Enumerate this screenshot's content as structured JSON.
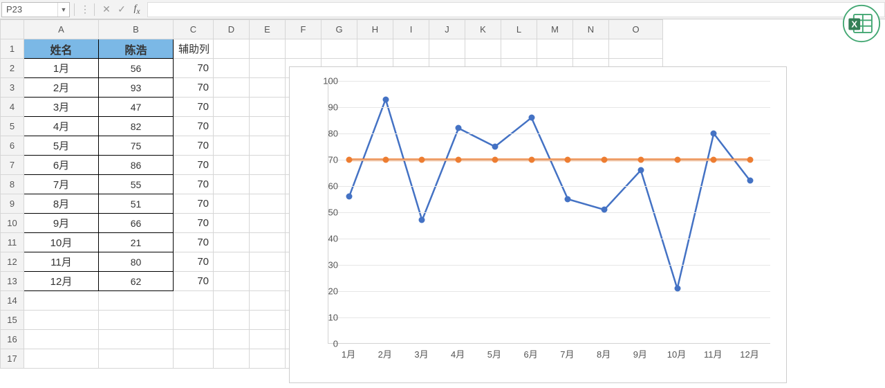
{
  "formula_bar": {
    "cell_ref": "P23",
    "formula": ""
  },
  "columns": [
    "A",
    "B",
    "C",
    "D",
    "E",
    "F",
    "G",
    "H",
    "I",
    "J",
    "K",
    "L",
    "M",
    "N",
    "O"
  ],
  "row_headers": [
    1,
    2,
    3,
    4,
    5,
    6,
    7,
    8,
    9,
    10,
    11,
    12,
    13,
    14,
    15,
    16,
    17
  ],
  "table": {
    "h_a": "姓名",
    "h_b": "陈浩",
    "h_c": "辅助列",
    "rows": [
      {
        "m": "1月",
        "v": 56,
        "a": 70
      },
      {
        "m": "2月",
        "v": 93,
        "a": 70
      },
      {
        "m": "3月",
        "v": 47,
        "a": 70
      },
      {
        "m": "4月",
        "v": 82,
        "a": 70
      },
      {
        "m": "5月",
        "v": 75,
        "a": 70
      },
      {
        "m": "6月",
        "v": 86,
        "a": 70
      },
      {
        "m": "7月",
        "v": 55,
        "a": 70
      },
      {
        "m": "8月",
        "v": 51,
        "a": 70
      },
      {
        "m": "9月",
        "v": 66,
        "a": 70
      },
      {
        "m": "10月",
        "v": 21,
        "a": 70
      },
      {
        "m": "11月",
        "v": 80,
        "a": 70
      },
      {
        "m": "12月",
        "v": 62,
        "a": 70
      }
    ]
  },
  "chart_data": {
    "type": "line",
    "categories": [
      "1月",
      "2月",
      "3月",
      "4月",
      "5月",
      "6月",
      "7月",
      "8月",
      "9月",
      "10月",
      "11月",
      "12月"
    ],
    "series": [
      {
        "name": "陈浩",
        "color": "#4472c4",
        "values": [
          56,
          93,
          47,
          82,
          75,
          86,
          55,
          51,
          66,
          21,
          80,
          62
        ]
      },
      {
        "name": "辅助列",
        "color": "#ed7d31",
        "values": [
          70,
          70,
          70,
          70,
          70,
          70,
          70,
          70,
          70,
          70,
          70,
          70
        ]
      }
    ],
    "ylim": [
      0,
      100
    ],
    "yticks": [
      0,
      10,
      20,
      30,
      40,
      50,
      60,
      70,
      80,
      90,
      100
    ],
    "title": "",
    "xlabel": "",
    "ylabel": ""
  }
}
